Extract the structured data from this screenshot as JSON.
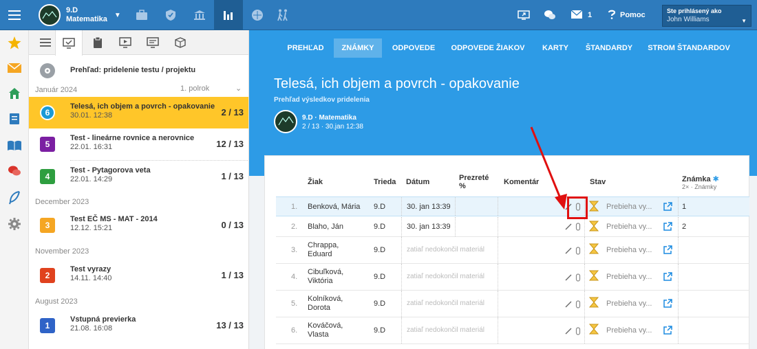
{
  "topbar": {
    "class_name": "9.D",
    "subject": "Matematika",
    "help_label": "Pomoc",
    "messages_count": "1",
    "login_label": "Ste prihlásený ako",
    "user_name": "John Williams"
  },
  "colors": {
    "brand_blue": "#2e7bbd",
    "header_blue": "#2d9be6",
    "active_yellow": "#ffc629",
    "alert_red": "#e01010"
  },
  "rail_icons": [
    "star-icon",
    "mail-icon",
    "home-icon",
    "notebook-icon",
    "book-icon",
    "chat-icon",
    "feather-icon",
    "gear-icon"
  ],
  "left_panel": {
    "overview_label": "Prehľad: pridelenie testu / projektu",
    "groups": [
      {
        "month": "Január 2024",
        "semester": "1. polrok"
      },
      {
        "month": "December 2023"
      },
      {
        "month": "November 2023"
      },
      {
        "month": "August 2023"
      }
    ],
    "tests": [
      {
        "badge": "6",
        "color": "#1a9ad6",
        "name": "Telesá, ich objem a povrch - opakovanie",
        "date": "30.01. 12:38",
        "count": "2 / 13"
      },
      {
        "badge": "5",
        "color": "#7b1fa2",
        "name": "Test - lineárne rovnice a nerovnice",
        "date": "22.01. 16:31",
        "count": "12 / 13"
      },
      {
        "badge": "4",
        "color": "#2e9e3f",
        "name": "Test - Pytagorova veta",
        "date": "22.01. 14:29",
        "count": "1 / 13"
      },
      {
        "badge": "3",
        "color": "#f5a623",
        "name": "Test EČ MS - MAT - 2014",
        "date": "12.12. 15:21",
        "count": "0 / 13"
      },
      {
        "badge": "2",
        "color": "#e0421e",
        "name": "Test vyrazy",
        "date": "14.11. 14:40",
        "count": "1 / 13"
      },
      {
        "badge": "1",
        "color": "#2f63c7",
        "name": "Vstupná previerka",
        "date": "21.08. 16:08",
        "count": "13 / 13"
      }
    ]
  },
  "nav": {
    "items": [
      "PREHĽAD",
      "ZNÁMKY",
      "ODPOVEDE",
      "ODPOVEDE ŽIAKOV",
      "KARTY",
      "ŠTANDARDY",
      "STROM ŠTANDARDOV"
    ],
    "active": "ZNÁMKY"
  },
  "page": {
    "title": "Telesá, ich objem a povrch - opakovanie",
    "subtitle": "Prehľad výsledkov pridelenia",
    "class_line": "9.D · Matematika",
    "info_line": "2 / 13 · 30.jan 12:38"
  },
  "table": {
    "headers": {
      "student": "Žiak",
      "class": "Trieda",
      "date": "Dátum",
      "viewed_1": "Prezreté",
      "viewed_2": "%",
      "comment": "Komentár",
      "status": "Stav",
      "grade": "Známka",
      "grade_sub": "2× · Známky"
    },
    "rows": [
      {
        "n": "1.",
        "name1": "Benková, Mária",
        "name2": "",
        "cls": "9.D",
        "date": "30. jan 13:39",
        "status": "Prebieha vy...",
        "grade": "1"
      },
      {
        "n": "2.",
        "name1": "Blaho, Ján",
        "name2": "",
        "cls": "9.D",
        "date": "30. jan 13:39",
        "status": "Prebieha vy...",
        "grade": "2"
      },
      {
        "n": "3.",
        "name1": "Chrappa,",
        "name2": "Eduard",
        "cls": "9.D",
        "date": "zatiaľ nedokončil materiál",
        "status": "Prebieha vy...",
        "grade": ""
      },
      {
        "n": "4.",
        "name1": "Cibuľková,",
        "name2": "Viktória",
        "cls": "9.D",
        "date": "zatiaľ nedokončil materiál",
        "status": "Prebieha vy...",
        "grade": ""
      },
      {
        "n": "5.",
        "name1": "Kolníková,",
        "name2": "Dorota",
        "cls": "9.D",
        "date": "zatiaľ nedokončil materiál",
        "status": "Prebieha vy...",
        "grade": ""
      },
      {
        "n": "6.",
        "name1": "Kováčová,",
        "name2": "Vlasta",
        "cls": "9.D",
        "date": "zatiaľ nedokončil materiál",
        "status": "Prebieha vy...",
        "grade": ""
      }
    ]
  }
}
